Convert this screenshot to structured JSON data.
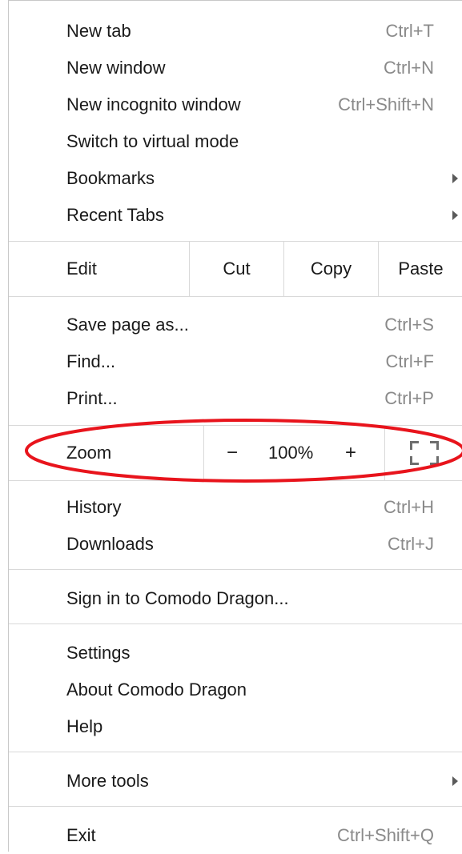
{
  "accent_color": "#e8141c",
  "menu": {
    "group1": [
      {
        "label": "New tab",
        "shortcut": "Ctrl+T"
      },
      {
        "label": "New window",
        "shortcut": "Ctrl+N"
      },
      {
        "label": "New incognito window",
        "shortcut": "Ctrl+Shift+N"
      },
      {
        "label": "Switch to virtual mode",
        "shortcut": ""
      },
      {
        "label": "Bookmarks",
        "submenu": true
      },
      {
        "label": "Recent Tabs",
        "submenu": true
      }
    ],
    "edit": {
      "label": "Edit",
      "cut": "Cut",
      "copy": "Copy",
      "paste": "Paste"
    },
    "group2": [
      {
        "label": "Save page as...",
        "shortcut": "Ctrl+S"
      },
      {
        "label": "Find...",
        "shortcut": "Ctrl+F"
      },
      {
        "label": "Print...",
        "shortcut": "Ctrl+P"
      }
    ],
    "zoom": {
      "label": "Zoom",
      "minus": "−",
      "value": "100%",
      "plus": "+",
      "fullscreen_icon": "fullscreen-icon"
    },
    "group3": [
      {
        "label": "History",
        "shortcut": "Ctrl+H"
      },
      {
        "label": "Downloads",
        "shortcut": "Ctrl+J"
      }
    ],
    "signin": {
      "label": "Sign in to Comodo Dragon..."
    },
    "group4": [
      {
        "label": "Settings"
      },
      {
        "label": "About Comodo Dragon"
      },
      {
        "label": "Help"
      }
    ],
    "more_tools": {
      "label": "More tools",
      "submenu": true
    },
    "exit": {
      "label": "Exit",
      "shortcut": "Ctrl+Shift+Q"
    }
  }
}
